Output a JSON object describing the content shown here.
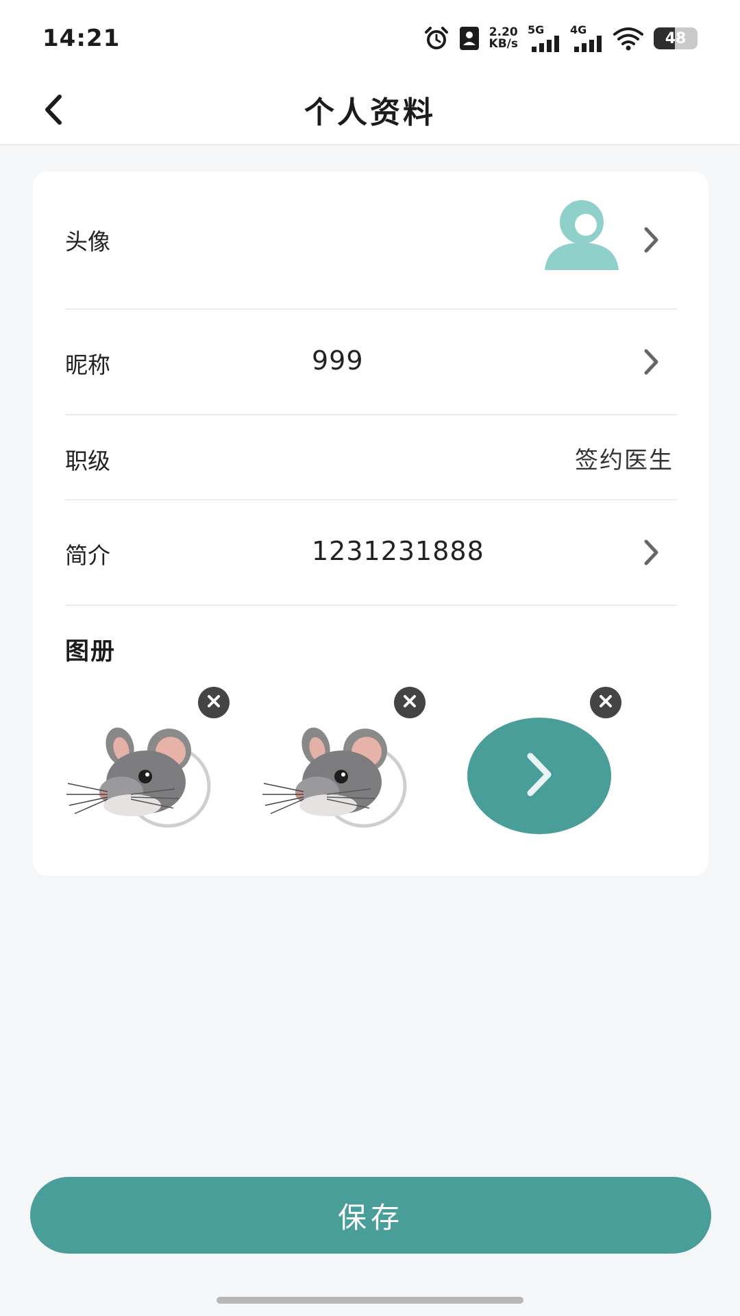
{
  "status_bar": {
    "time": "14:21",
    "net_speed_value": "2.20",
    "net_speed_unit": "KB/s",
    "signal_1_label": "5G",
    "signal_2_label": "4G",
    "battery_level": "48",
    "icons": [
      "alarm-icon",
      "contact-card-icon",
      "signal-5g-icon",
      "signal-4g-icon",
      "wifi-icon",
      "battery-icon"
    ]
  },
  "nav": {
    "title": "个人资料",
    "back_icon": "chevron-left-icon"
  },
  "profile": {
    "avatar": {
      "label": "头像",
      "icon": "default-user-avatar"
    },
    "nickname": {
      "label": "昵称",
      "value": "999"
    },
    "rank": {
      "label": "职级",
      "value": "签约医生"
    },
    "bio": {
      "label": "简介",
      "value": "1231231888"
    }
  },
  "album": {
    "title": "图册",
    "photos": [
      {
        "image": "mouse-illustration"
      },
      {
        "image": "mouse-illustration"
      }
    ],
    "add_icon": "chevron-right-icon"
  },
  "actions": {
    "save_label": "保存"
  },
  "colors": {
    "accent": "#4a9e9a",
    "avatar": "#8fd0cb",
    "background": "#f5f6f8",
    "card": "#ffffff"
  }
}
